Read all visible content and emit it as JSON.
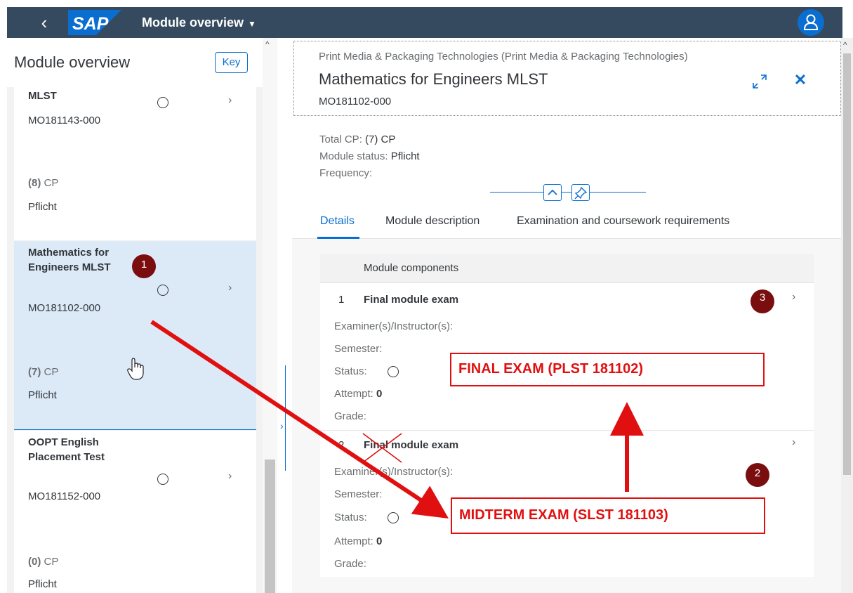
{
  "shell": {
    "back_icon": "chevron-left-icon",
    "logo_text": "SAP",
    "title": "Module overview",
    "caret": "▼",
    "avatar_icon": "user-icon",
    "colors": {
      "shell_bg": "#354a5f",
      "accent": "#0a6ed1",
      "logo": "#0a6ed1"
    }
  },
  "master": {
    "title": "Module overview",
    "key_button": "Key",
    "items": [
      {
        "title": "MLST",
        "id": "MO181143-000",
        "cp_value": "(8)",
        "cp_unit": "CP",
        "status": "Pflicht"
      },
      {
        "title": "Mathematics for Engineers MLST",
        "id": "MO181102-000",
        "cp_value": "(7)",
        "cp_unit": "CP",
        "status": "Pflicht"
      },
      {
        "title": "OOPT English Placement Test",
        "id": "MO181152-000",
        "cp_value": "(0)",
        "cp_unit": "CP",
        "status": "Pflicht"
      }
    ]
  },
  "detail": {
    "breadcrumb": "Print Media & Packaging Technologies (Print Media & Packaging Technologies)",
    "title": "Mathematics for Engineers MLST",
    "module_id": "MO181102-000",
    "total_cp_label": "Total CP:",
    "total_cp_value": "(7) CP",
    "module_status_label": "Module status:",
    "module_status_value": "Pflicht",
    "frequency_label": "Frequency:",
    "tabs": [
      {
        "label": "Details"
      },
      {
        "label": "Module description"
      },
      {
        "label": "Examination and coursework requirements"
      }
    ],
    "components": {
      "header": "Module components",
      "rows": [
        {
          "num": "1",
          "name": "Final module exam",
          "examiner_label": "Examiner(s)/Instructor(s):",
          "semester_label": "Semester:",
          "status_label": "Status:",
          "attempt_label": "Attempt:",
          "attempt_value": "0",
          "grade_label": "Grade:"
        },
        {
          "num": "2",
          "name": "Final module exam",
          "examiner_label": "Examiner(s)/Instructor(s):",
          "semester_label": "Semester:",
          "status_label": "Status:",
          "attempt_label": "Attempt:",
          "attempt_value": "0",
          "grade_label": "Grade:"
        }
      ]
    }
  },
  "annotations": {
    "badge_1": "1",
    "badge_2": "2",
    "badge_3": "3",
    "final_exam_note": "FINAL EXAM (PLST 181102)",
    "midterm_exam_note": "MIDTERM EXAM (SLST 181103)",
    "arrow_color": "#e01010",
    "badge_color": "#7a0e0e"
  }
}
